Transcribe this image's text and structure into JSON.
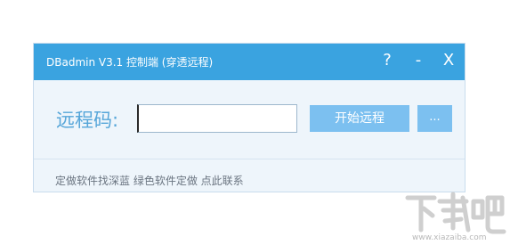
{
  "window": {
    "title": "DBadmin V3.1 控制端 (穿透远程)",
    "help_label": "?",
    "minimize_label": "-",
    "close_label": "X"
  },
  "form": {
    "remote_code_label": "远程码:",
    "remote_code_value": "",
    "start_button_label": "开始远程",
    "more_button_label": "..."
  },
  "footer": {
    "text": "定做软件找深蓝 绿色软件定做 ",
    "link_text": "点此联系"
  },
  "watermark": {
    "site": "www.xiazaiba.com",
    "logo_text": "下载吧"
  },
  "colors": {
    "titlebar": "#3aa3e0",
    "button": "#7cc0f0",
    "label": "#56a6d9",
    "panel": "#eef5fb"
  }
}
